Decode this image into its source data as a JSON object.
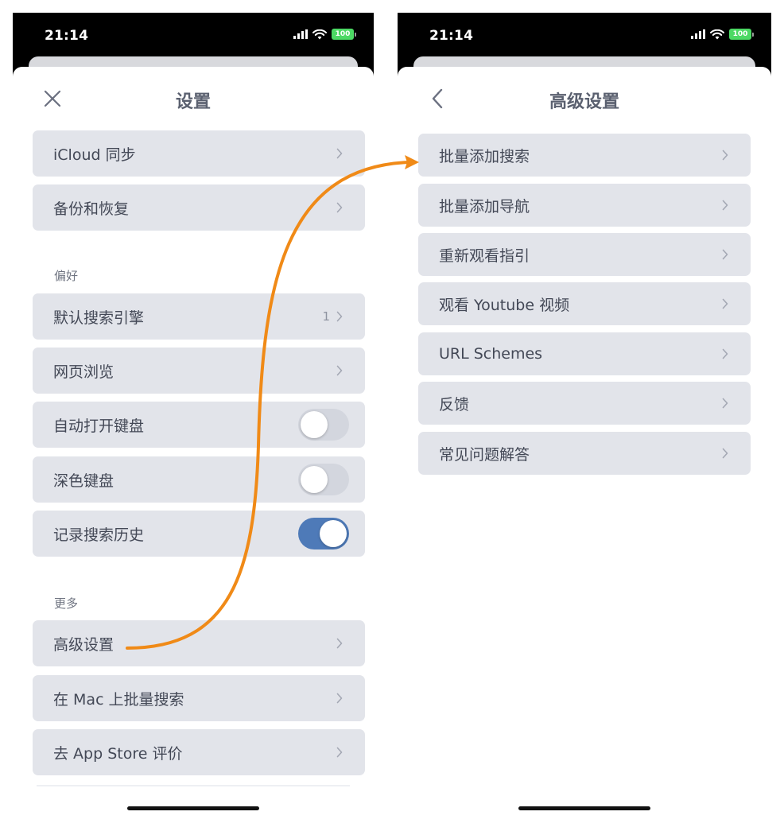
{
  "left": {
    "status_time": "21:14",
    "battery": "100",
    "title": "设置",
    "items": [
      {
        "label": "iCloud 同步"
      },
      {
        "label": "备份和恢复"
      }
    ],
    "section_prefs": "偏好",
    "prefs": [
      {
        "label": "默认搜索引擎",
        "value": "1"
      },
      {
        "label": "网页浏览"
      },
      {
        "label": "自动打开键盘",
        "toggle": false
      },
      {
        "label": "深色键盘",
        "toggle": false
      },
      {
        "label": "记录搜索历史",
        "toggle": true
      }
    ],
    "section_more": "更多",
    "more": [
      {
        "label": "高级设置"
      },
      {
        "label": "在 Mac 上批量搜索"
      },
      {
        "label": "去 App Store 评价"
      }
    ]
  },
  "right": {
    "status_time": "21:14",
    "battery": "100",
    "title": "高级设置",
    "items": [
      {
        "label": "批量添加搜索"
      },
      {
        "label": "批量添加导航"
      },
      {
        "label": "重新观看指引"
      },
      {
        "label": "观看 Youtube 视频"
      },
      {
        "label": "URL Schemes"
      },
      {
        "label": "反馈"
      },
      {
        "label": "常见问题解答"
      }
    ]
  },
  "colors": {
    "row_bg": "#e2e4ea",
    "toggle_on": "#4e7ab8",
    "arrow": "#f08a17"
  },
  "icons": {
    "close": "close-icon",
    "back": "chevron-left-icon",
    "row": "chevron-right-icon"
  }
}
